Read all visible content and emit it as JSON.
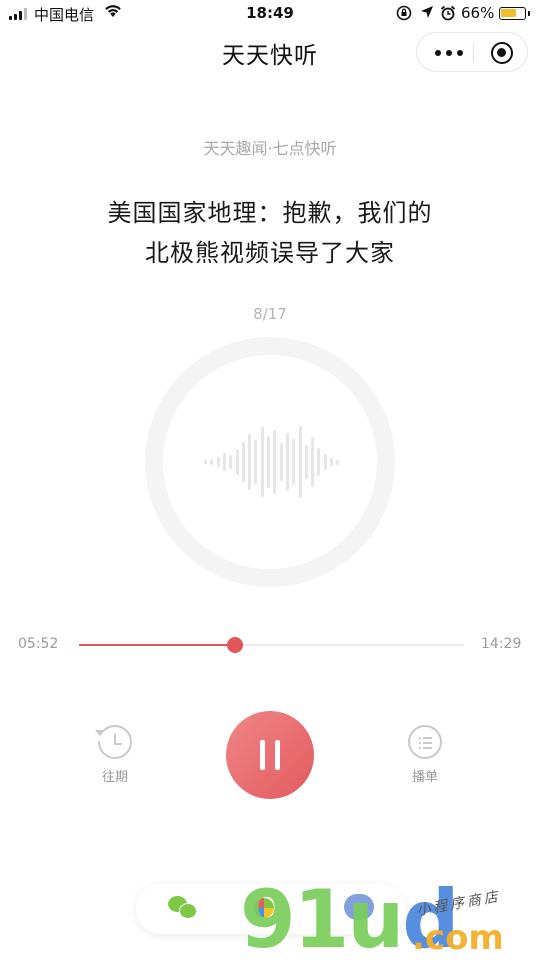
{
  "status_bar": {
    "carrier": "中国电信",
    "time": "18:49",
    "battery_percent": "66%",
    "battery_level": 0.66,
    "battery_color": "#f0c02a",
    "icons": [
      "signal-icon",
      "wifi-icon",
      "rotation-lock-icon",
      "location-icon",
      "alarm-icon",
      "battery-icon"
    ]
  },
  "nav": {
    "title": "天天快听",
    "capsule_icons": [
      "more-icon",
      "close-miniprogram-icon"
    ]
  },
  "player": {
    "program": "天天趣闻·七点快听",
    "headline_line1": "美国国家地理：抱歉，我们的",
    "headline_line2": "北极熊视频误导了大家",
    "counter": "8/17",
    "elapsed": "05:52",
    "duration": "14:29",
    "progress": 0.405,
    "accent_color": "#e25659",
    "visual_icon": "audio-waveform-icon"
  },
  "controls": {
    "history_label": "往期",
    "history_icon": "history-clock-icon",
    "pause_icon": "pause-icon",
    "playlist_label": "播单",
    "playlist_icon": "playlist-icon"
  },
  "share_bar": {
    "icons": [
      "wechat-icon",
      "moments-icon",
      "share-icon"
    ]
  },
  "watermark": {
    "logo_text_green": "91u",
    "logo_text_blue": "d",
    "logo_suffix": ".com",
    "script_text": "小程序商店"
  }
}
